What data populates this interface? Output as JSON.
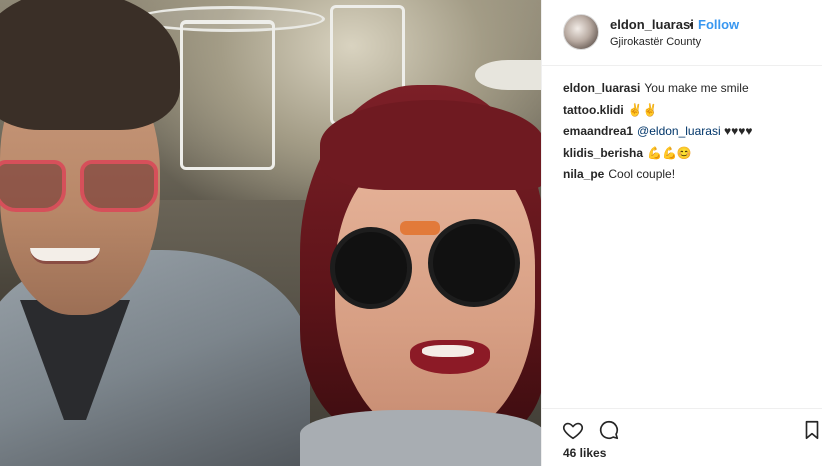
{
  "post": {
    "author": {
      "username": "eldon_luarasi",
      "separator": "•",
      "follow_label": "Follow",
      "location": "Gjirokastër County"
    },
    "comments": [
      {
        "user": "eldon_luarasi",
        "text": "You make me smile"
      },
      {
        "user": "tattoo.klidi",
        "text": "✌✌"
      },
      {
        "user": "emaandrea1",
        "mention": "@eldon_luarasi",
        "text": "♥♥♥♥"
      },
      {
        "user": "klidis_berisha",
        "text": "💪💪😊"
      },
      {
        "user": "nila_pe",
        "text": "Cool couple!"
      }
    ],
    "actions": {
      "like_icon": "heart-icon",
      "comment_icon": "comment-icon",
      "save_icon": "bookmark-icon"
    },
    "likes": "46 likes"
  },
  "colors": {
    "accent": "#3897f0",
    "text": "#262626",
    "border": "#efefef"
  }
}
